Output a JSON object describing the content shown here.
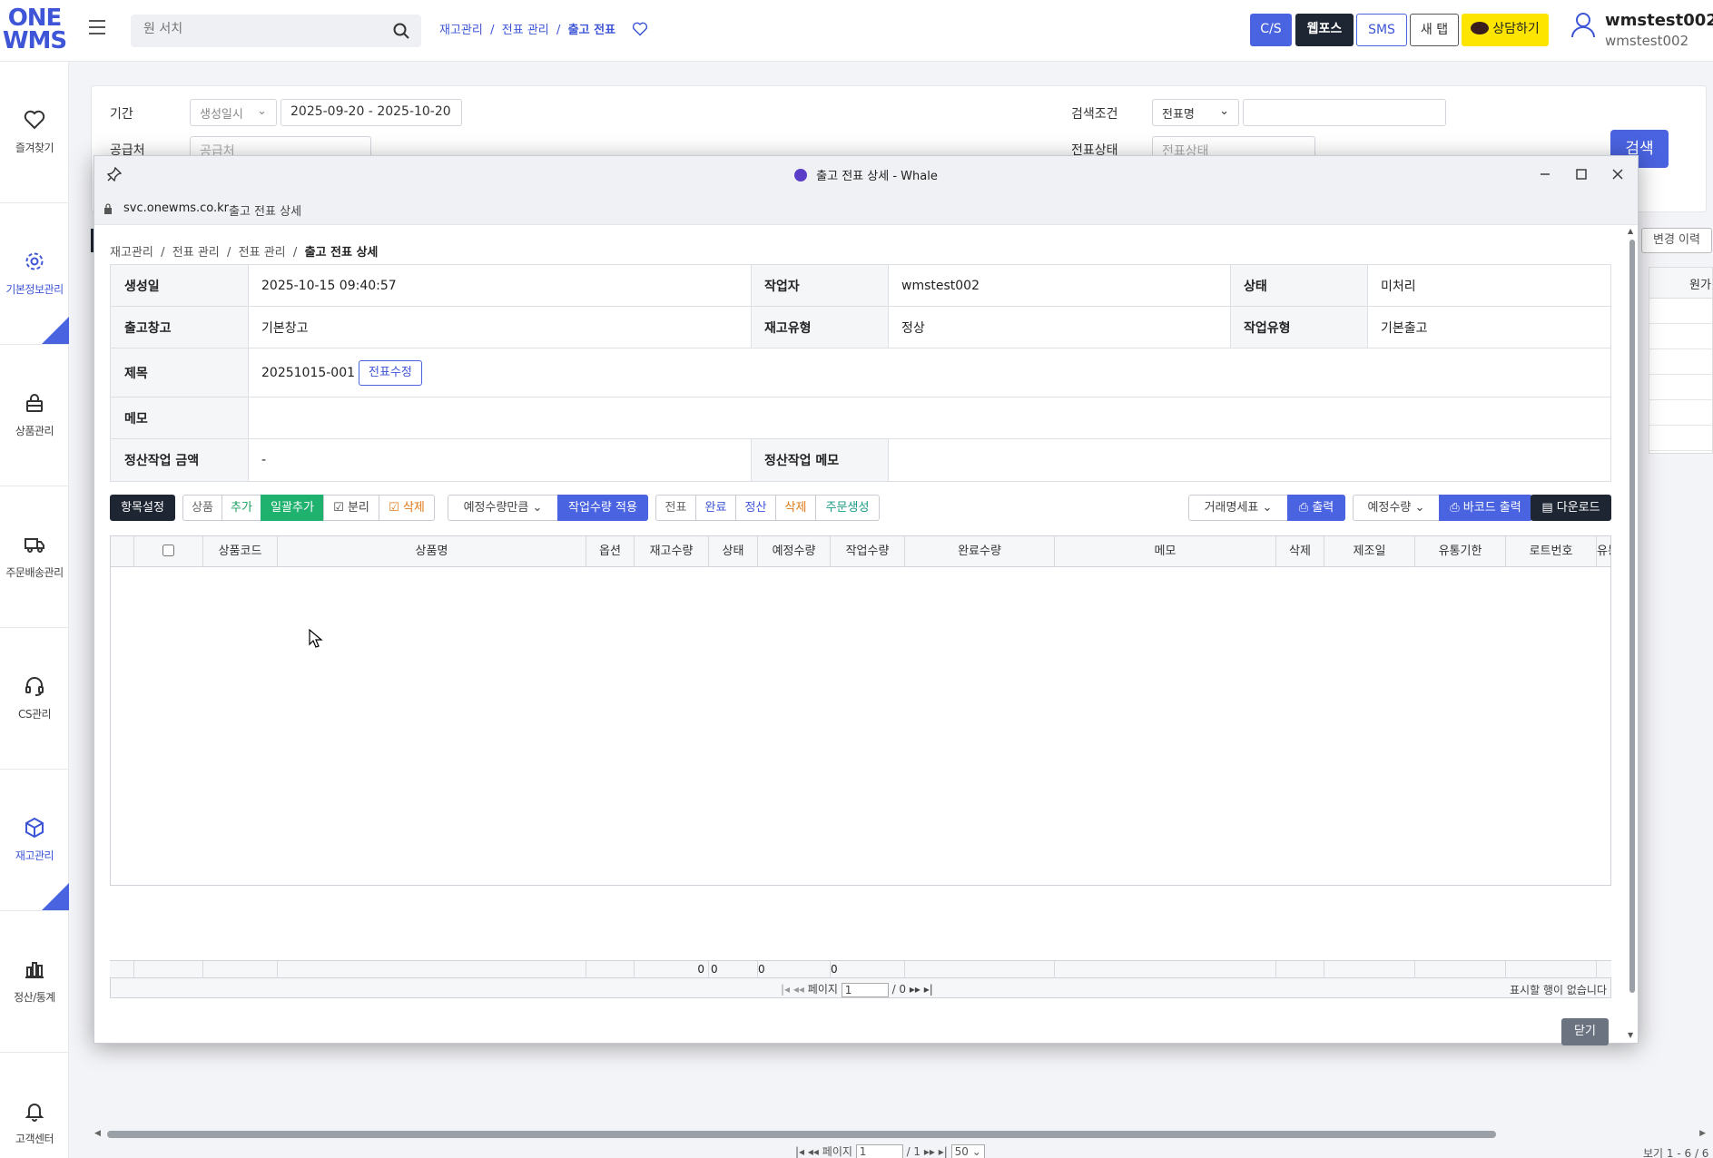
{
  "header": {
    "logo_line1": "ONE",
    "logo_line2": "WMS",
    "search_placeholder": "원 서치",
    "breadcrumb": [
      "재고관리",
      "전표 관리",
      "출고 전표"
    ],
    "buttons": {
      "cs": "C/S",
      "webpos": "웹포스",
      "sms": "SMS",
      "newtab": "새 탭",
      "consult": "상담하기"
    },
    "user_name": "wmstest002",
    "user_id": "wmstest002",
    "colors": {
      "primary": "#4a63e0",
      "dark": "#1f2633",
      "kakao": "#fee500"
    }
  },
  "sidebar": {
    "items": [
      {
        "label": "즐겨찾기",
        "icon": "heart-icon"
      },
      {
        "label": "기본정보관리",
        "icon": "gear-icon"
      },
      {
        "label": "상품관리",
        "icon": "lock-bag-icon"
      },
      {
        "label": "주문배송관리",
        "icon": "truck-icon"
      },
      {
        "label": "CS관리",
        "icon": "headset-icon"
      },
      {
        "label": "재고관리",
        "icon": "box-icon"
      },
      {
        "label": "정산/통계",
        "icon": "bar-chart-icon"
      },
      {
        "label": "고객센터",
        "icon": "bell-icon"
      }
    ]
  },
  "bg": {
    "period_label": "기간",
    "period_select": "생성일시",
    "period_value": "2025-09-20 - 2025-10-20",
    "supplier_label": "공급처",
    "supplier_placeholder": "공급처",
    "cond_label": "검색조건",
    "cond_select": "전표명",
    "status_label": "전표상태",
    "status_placeholder": "전표상태",
    "search_btn": "검색",
    "changelog_btn": "변경 이력",
    "col_partial": "원가",
    "pager": {
      "page_label": "페이지",
      "page": "1",
      "total": "/ 1",
      "per_page": "50"
    },
    "view_text": "보기 1 - 6 / 6"
  },
  "popup": {
    "window_title": "출고 전표 상세 - Whale",
    "address_host": "svc.onewms.co.kr",
    "address_title": "출고 전표 상세",
    "breadcrumb": [
      "재고관리",
      "전표 관리",
      "전표 관리"
    ],
    "breadcrumb_current": "출고 전표 상세",
    "detail": {
      "created_label": "생성일",
      "created_value": "2025-10-15 09:40:57",
      "worker_label": "작업자",
      "worker_value": "wmstest002",
      "status_label": "상태",
      "status_value": "미처리",
      "warehouse_label": "출고창고",
      "warehouse_value": "기본창고",
      "stock_type_label": "재고유형",
      "stock_type_value": "정상",
      "work_type_label": "작업유형",
      "work_type_value": "기본출고",
      "title_label": "제목",
      "title_value": "20251015-001",
      "edit_btn": "전표수정",
      "memo_label": "메모",
      "memo_value": "",
      "settle_amount_label": "정산작업 금액",
      "settle_amount_value": "-",
      "settle_memo_label": "정산작업 메모",
      "settle_memo_value": ""
    },
    "toolbar": {
      "item_settings": "항목설정",
      "product": "상품",
      "add": "추가",
      "bulk_add": "일괄추가",
      "split": "분리",
      "delete": "삭제",
      "qty_select": "예정수량만큼",
      "apply_qty": "작업수량 적용",
      "slip": "전표",
      "complete": "완료",
      "settle": "정산",
      "delete2": "삭제",
      "create_order": "주문생성",
      "invoice_select": "거래명세표",
      "print": "출력",
      "expected_select": "예정수량",
      "barcode_print": "바코드 출력",
      "download": "다운로드"
    },
    "grid": {
      "columns": [
        "",
        "",
        "상품코드",
        "상품명",
        "옵션",
        "재고수량",
        "상태",
        "예정수량",
        "작업수량",
        "완료수량",
        "메모",
        "삭제",
        "제조일",
        "유통기한",
        "로트번호",
        "유통"
      ],
      "totals": {
        "stock": "0",
        "expected": "0",
        "work": "0",
        "done": "0"
      },
      "pager": {
        "page_label": "페이지",
        "page": "1",
        "total": "/ 0"
      },
      "no_rows": "표시할 행이 없습니다"
    },
    "close_btn": "닫기"
  }
}
